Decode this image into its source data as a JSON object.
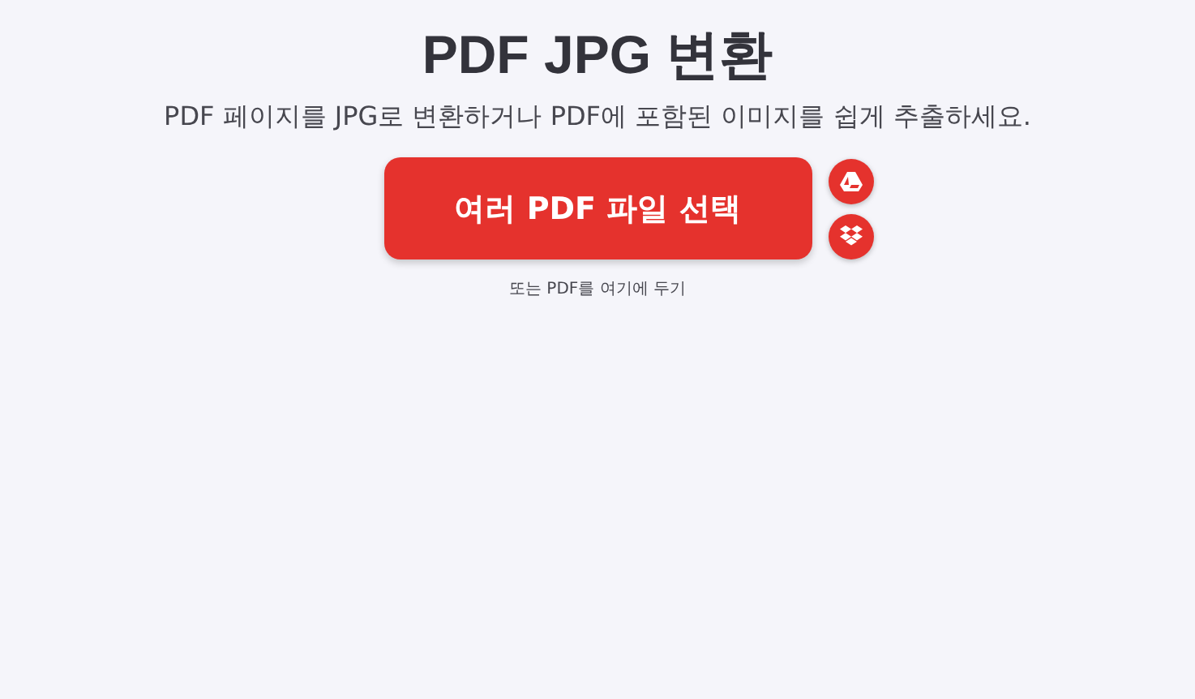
{
  "title": "PDF JPG 변환",
  "subtitle": "PDF 페이지를 JPG로 변환하거나 PDF에 포함된 이미지를 쉽게 추출하세요.",
  "upload_button": {
    "label": "여러 PDF 파일 선택"
  },
  "cloud_buttons": [
    {
      "kind": "drive"
    },
    {
      "kind": "dropbox"
    }
  ],
  "drop_hint": "또는 PDF를 여기에 두기"
}
